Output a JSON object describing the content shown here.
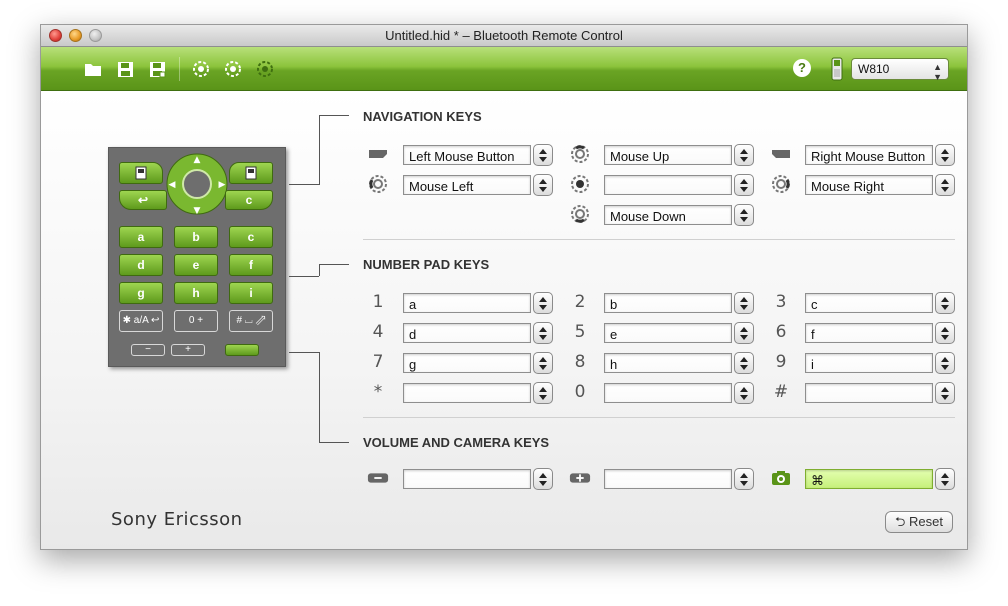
{
  "window": {
    "title": "Untitled.hid * – Bluetooth Remote Control"
  },
  "toolbar": {
    "buttons": [
      {
        "name": "open",
        "icon": "folder-icon"
      },
      {
        "name": "save",
        "icon": "save-icon"
      },
      {
        "name": "save-as",
        "icon": "save-as-icon"
      },
      {
        "name": "connect",
        "icon": "bluetooth-connect-icon"
      },
      {
        "name": "refresh",
        "icon": "bluetooth-refresh-icon"
      },
      {
        "name": "disconnect",
        "icon": "bluetooth-disconnect-icon"
      }
    ],
    "help_label": "?",
    "model": "W810"
  },
  "sections": {
    "navigation": {
      "title": "NAVIGATION KEYS",
      "left_mouse": "Left Mouse Button",
      "mouse_up": "Mouse Up",
      "right_mouse": "Right Mouse Button",
      "mouse_left": "Mouse Left",
      "center": "",
      "mouse_right": "Mouse Right",
      "mouse_down": "Mouse Down"
    },
    "numpad": {
      "title": "NUMBER PAD KEYS",
      "rows": [
        [
          {
            "key": "1",
            "value": "a"
          },
          {
            "key": "2",
            "value": "b"
          },
          {
            "key": "3",
            "value": "c"
          }
        ],
        [
          {
            "key": "4",
            "value": "d"
          },
          {
            "key": "5",
            "value": "e"
          },
          {
            "key": "6",
            "value": "f"
          }
        ],
        [
          {
            "key": "7",
            "value": "g"
          },
          {
            "key": "8",
            "value": "h"
          },
          {
            "key": "9",
            "value": "i"
          }
        ],
        [
          {
            "key": "*",
            "value": ""
          },
          {
            "key": "0",
            "value": ""
          },
          {
            "key": "#",
            "value": ""
          }
        ]
      ]
    },
    "volume": {
      "title": "VOLUME AND CAMERA KEYS",
      "vol_down": "",
      "vol_up": "",
      "camera": "⌘"
    }
  },
  "phone": {
    "keys": [
      "a",
      "b",
      "c",
      "d",
      "e",
      "f",
      "g",
      "h",
      "i"
    ],
    "clear_label": "c",
    "back_label": "↩",
    "star_label": "✱ a/A ↩",
    "zero_label": "0 +",
    "hash_label": "# ⌴ ⇗"
  },
  "brand": "Sony Ericsson",
  "reset_label": "Reset",
  "colors": {
    "toolbar_green": "#7ab830",
    "field_green": "#c6f07a",
    "panel_gray": "#6e6e6e"
  }
}
